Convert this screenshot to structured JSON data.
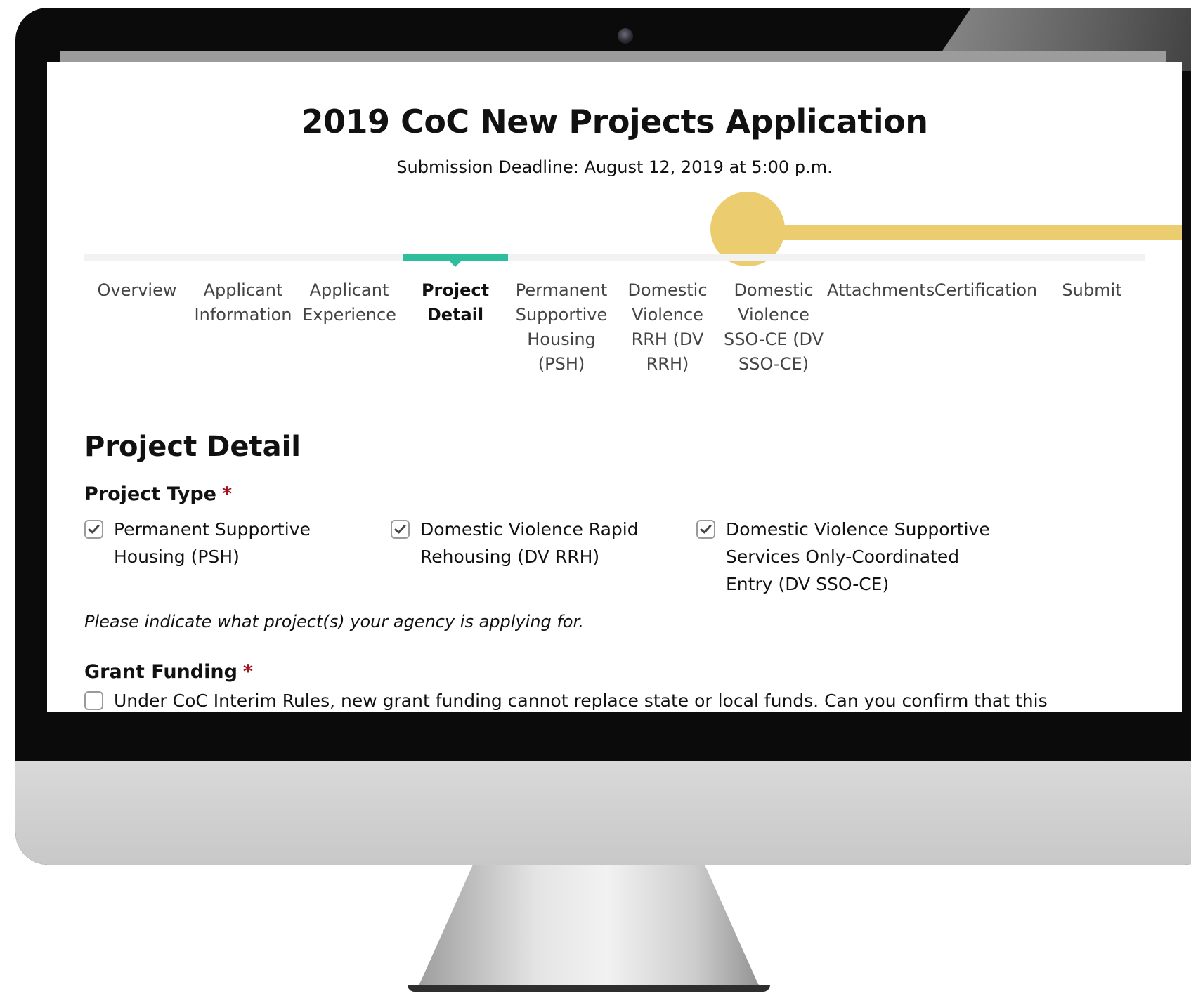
{
  "header": {
    "title": "2019 CoC New Projects Application",
    "deadline": "Submission Deadline: August 12, 2019 at 5:00 p.m."
  },
  "steps": [
    {
      "label": "Overview",
      "active": false
    },
    {
      "label": "Applicant Information",
      "active": false
    },
    {
      "label": "Applicant Experience",
      "active": false
    },
    {
      "label": "Project Detail",
      "active": true
    },
    {
      "label": "Permanent Supportive Housing (PSH)",
      "active": false
    },
    {
      "label": "Domestic Violence RRH (DV RRH)",
      "active": false
    },
    {
      "label": "Domestic Violence SSO-CE (DV SSO-CE)",
      "active": false
    },
    {
      "label": "Attachments",
      "active": false
    },
    {
      "label": "Certification",
      "active": false
    },
    {
      "label": "Submit",
      "active": false
    }
  ],
  "form": {
    "section_title": "Project Detail",
    "project_type": {
      "label": "Project Type",
      "required_mark": "*",
      "options": [
        {
          "label": "Permanent Supportive Housing (PSH)",
          "checked": true
        },
        {
          "label": "Domestic Violence Rapid Rehousing (DV RRH)",
          "checked": true
        },
        {
          "label": "Domestic Violence Supportive Services Only-Coordinated Entry (DV SSO-CE)",
          "checked": true
        }
      ],
      "hint": "Please indicate what project(s) your agency is applying for."
    },
    "grant_funding": {
      "label": "Grant Funding",
      "required_mark": "*",
      "question": "Under CoC Interim Rules, new grant funding cannot replace state or local funds. Can you confirm that this",
      "checked": false
    }
  },
  "colors": {
    "active_step": "#2ebd9d",
    "required": "#a01420",
    "accent": "#ebcc6e"
  }
}
